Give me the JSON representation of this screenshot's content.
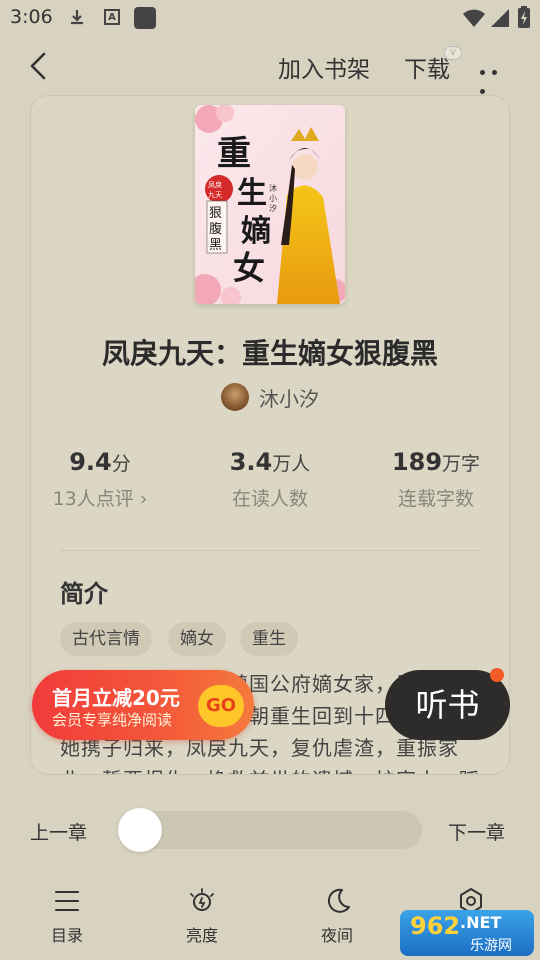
{
  "status_bar": {
    "time": "3:06",
    "icons": [
      "download-icon",
      "a-box-icon",
      "square-app-icon",
      "wifi-icon",
      "signal-icon",
      "battery-charging-icon"
    ]
  },
  "header": {
    "add_shelf": "加入书架",
    "download": "下载",
    "vip_badge": "V"
  },
  "book": {
    "title": "凤戾九天：重生嫡女狠腹黑",
    "author": "沐小汐",
    "cover_text": {
      "big": "重生嫡女",
      "sub": "狠腹黑",
      "seal": "凤戾九天",
      "author_small": "沐小汐著"
    }
  },
  "stats": [
    {
      "value": "9.4",
      "unit": "分",
      "label": "13人点评 ›"
    },
    {
      "value": "3.4",
      "unit": "万人",
      "label": "在读人数"
    },
    {
      "value": "189",
      "unit": "万字",
      "label": "连载字数"
    }
  ],
  "intro": {
    "title": "简介",
    "tags": [
      "古代言情",
      "嫡女",
      "重生"
    ],
    "text": "前世她是天之骄女镇国公府嫡女家，原本恩爱夫君竟是枕边狼，一朝重生回到十四岁那年，她携子归来，凤戾九天，复仇虐渣，重振家业，誓要报仇，挽救前世的遗憾，护家人，踩渣男，手撕白莲花，狂打小人，步步为营……"
  },
  "promo": {
    "main": "首月立减20元",
    "sub": "会员专享纯净阅读",
    "go": "GO"
  },
  "listen": {
    "label": "听书"
  },
  "chapter_nav": {
    "prev": "上一章",
    "next": "下一章",
    "progress": 0
  },
  "toolbar": [
    {
      "icon": "list-icon",
      "label": "目录"
    },
    {
      "icon": "brightness-icon",
      "label": "亮度"
    },
    {
      "icon": "moon-icon",
      "label": "夜间"
    },
    {
      "icon": "settings-icon",
      "label": "设置"
    }
  ],
  "watermark": {
    "num": "962",
    "net": ".NET",
    "cn": "乐游网"
  }
}
